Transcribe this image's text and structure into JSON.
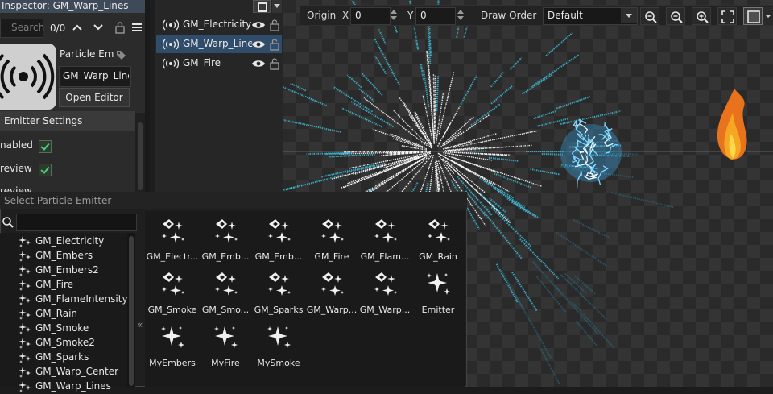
{
  "inspector": {
    "title": "Inspector: GM_Warp_Lines",
    "search_placeholder": "Search",
    "match_count": "0/0",
    "particle_label": "Particle Em",
    "name_value": "GM_Warp_Line",
    "open_editor_label": "Open Editor",
    "emitter_settings_header": "Emitter Settings",
    "enabled_label": "nabled",
    "preview_label": "review",
    "cut_label": "review"
  },
  "emitter_list": {
    "items": [
      {
        "label": "GM_Electricity",
        "selected": false
      },
      {
        "label": "GM_Warp_Lines",
        "selected": true
      },
      {
        "label": "GM_Fire",
        "selected": false
      }
    ]
  },
  "toolbar": {
    "origin_label": "Origin",
    "x_label": "X",
    "x_value": "0",
    "y_label": "Y",
    "y_value": "0",
    "draw_order_label": "Draw Order",
    "draw_order_value": "Default"
  },
  "picker": {
    "title": "Select Particle Emitter",
    "search_value": "",
    "list": [
      "GM_Electricity",
      "GM_Embers",
      "GM_Embers2",
      "GM_Fire",
      "GM_FlameIntensity",
      "GM_Rain",
      "GM_Smoke",
      "GM_Smoke2",
      "GM_Sparks",
      "GM_Warp_Center",
      "GM_Warp_Lines"
    ],
    "grid": [
      {
        "label": "GM_Electr...",
        "icon": "gm-emitter-icon"
      },
      {
        "label": "GM_Emb...",
        "icon": "gm-emitter-icon"
      },
      {
        "label": "GM_Emb...",
        "icon": "gm-emitter-icon"
      },
      {
        "label": "GM_Fire",
        "icon": "gm-emitter-icon"
      },
      {
        "label": "GM_Flam...",
        "icon": "gm-emitter-icon"
      },
      {
        "label": "GM_Rain",
        "icon": "gm-emitter-icon"
      },
      {
        "label": "GM_Smoke",
        "icon": "gm-emitter-icon"
      },
      {
        "label": "GM_Smo...",
        "icon": "gm-emitter-icon"
      },
      {
        "label": "GM_Sparks",
        "icon": "gm-emitter-icon"
      },
      {
        "label": "GM_Warp...",
        "icon": "gm-emitter-icon"
      },
      {
        "label": "GM_Warp...",
        "icon": "gm-emitter-icon"
      },
      {
        "label": "Emitter",
        "icon": "sparkle-emitter-icon"
      },
      {
        "label": "MyEmbers",
        "icon": "sparkle-emitter-icon"
      },
      {
        "label": "MyFire",
        "icon": "sparkle-emitter-icon"
      },
      {
        "label": "MySmoke",
        "icon": "sparkle-emitter-icon"
      }
    ]
  },
  "colors": {
    "selection": "#2f4c6a",
    "warp_cyan": "#3fc8e8",
    "fire_orange": "#f5a623",
    "check_green": "#49d17a"
  }
}
